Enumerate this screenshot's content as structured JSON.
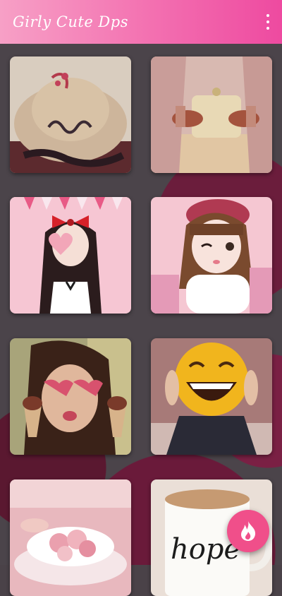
{
  "app_bar": {
    "title": "Girly Cute Dps",
    "overflow_icon": "more-vert-icon"
  },
  "gallery": {
    "items": [
      {
        "name": "hat-happy-photo"
      },
      {
        "name": "clutch-bag-henna-photo"
      },
      {
        "name": "cartoon-girl-heart-photo"
      },
      {
        "name": "cartoon-girl-winking-photo"
      },
      {
        "name": "girl-heart-glasses-photo"
      },
      {
        "name": "laughing-emoji-pillow-photo"
      },
      {
        "name": "rose-teacup-photo"
      },
      {
        "name": "hope-mug-photo"
      }
    ]
  },
  "fab": {
    "icon": "flame-icon"
  },
  "colors": {
    "accent": "#ee4aa0",
    "fab": "#f04f8a"
  }
}
